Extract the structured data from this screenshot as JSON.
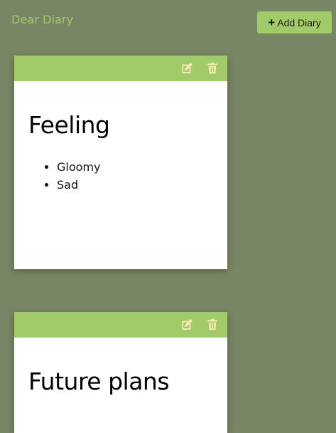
{
  "header": {
    "title": "Dear Diary",
    "add_button_icon": "plus-icon",
    "add_button_label": "Add Diary"
  },
  "colors": {
    "background": "#798665",
    "accent": "#a1cb68",
    "icon": "#f1e9b0"
  },
  "diaries": [
    {
      "title": "Feeling",
      "items": [
        "Gloomy",
        "Sad"
      ],
      "icons": [
        "edit-icon",
        "trash-icon"
      ]
    },
    {
      "title": "Future plans",
      "items": [],
      "icons": [
        "edit-icon",
        "trash-icon"
      ]
    }
  ]
}
